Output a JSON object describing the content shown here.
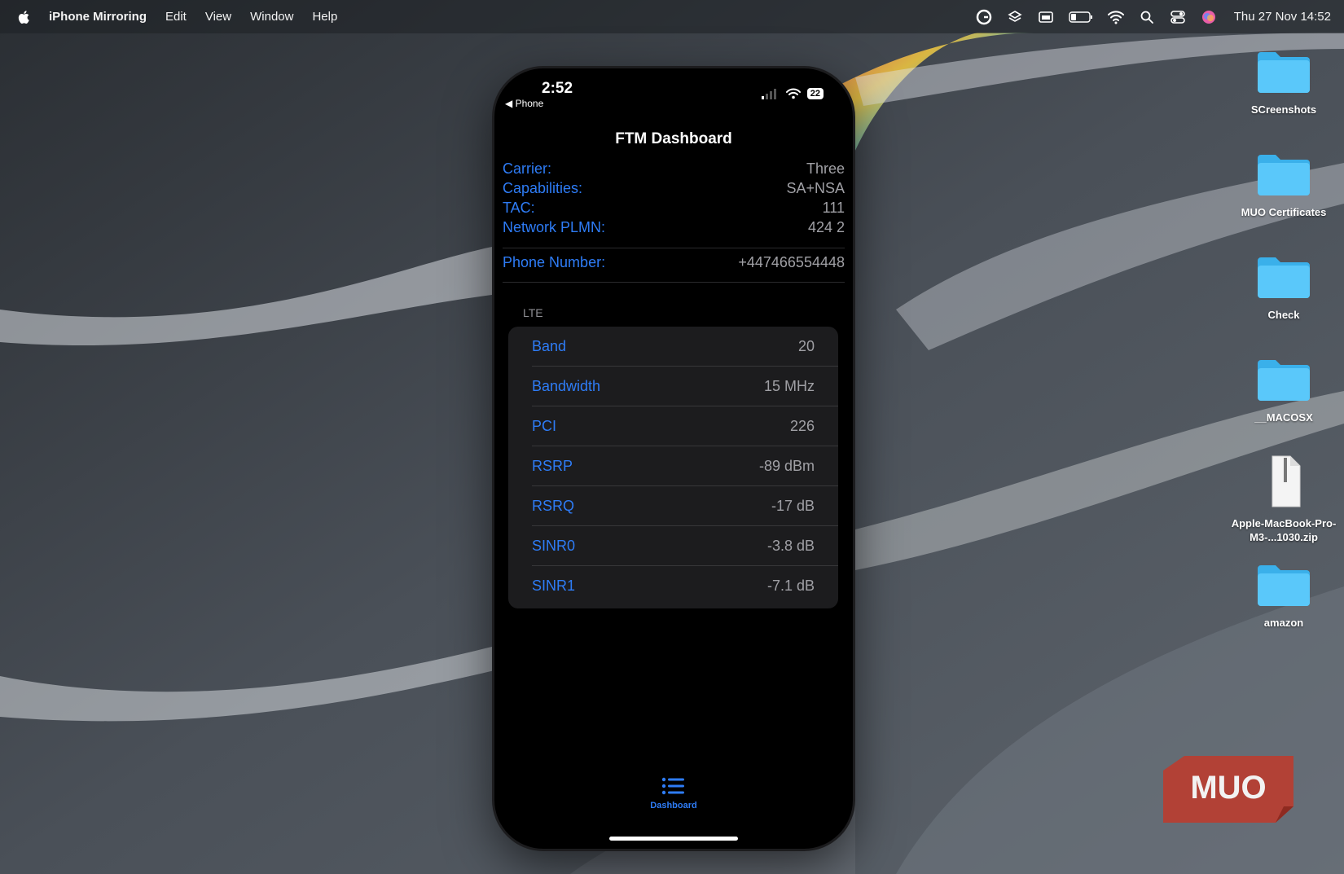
{
  "menubar": {
    "app_name": "iPhone Mirroring",
    "items": [
      "Edit",
      "View",
      "Window",
      "Help"
    ],
    "clock": "Thu 27 Nov  14:52"
  },
  "desktop": {
    "items": [
      {
        "label": "SCreenshots",
        "type": "folder"
      },
      {
        "label": "MUO Certificates",
        "type": "folder"
      },
      {
        "label": "Check",
        "type": "folder"
      },
      {
        "label": "__MACOSX",
        "type": "folder"
      },
      {
        "label": "Apple-MacBook-Pro-M3-...1030.zip",
        "type": "zip",
        "badge": "ZIP"
      },
      {
        "label": "amazon",
        "type": "folder"
      }
    ]
  },
  "phone": {
    "time": "2:52",
    "back_label": "◀ Phone",
    "battery": "22",
    "title": "FTM Dashboard",
    "info": [
      {
        "key": "Carrier:",
        "value": "Three"
      },
      {
        "key": "Capabilities:",
        "value": "SA+NSA"
      },
      {
        "key": "TAC:",
        "value": "111"
      },
      {
        "key": "Network PLMN:",
        "value": "424 2"
      }
    ],
    "phone_number": {
      "key": "Phone Number:",
      "value": "+447466554448"
    },
    "section": "LTE",
    "rows": [
      {
        "key": "Band",
        "value": "20"
      },
      {
        "key": "Bandwidth",
        "value": "15 MHz"
      },
      {
        "key": "PCI",
        "value": "226"
      },
      {
        "key": "RSRP",
        "value": "-89 dBm"
      },
      {
        "key": "RSRQ",
        "value": "-17 dB"
      },
      {
        "key": "SINR0",
        "value": "-3.8 dB"
      },
      {
        "key": "SINR1",
        "value": "-7.1 dB"
      }
    ],
    "tab": {
      "label": "Dashboard",
      "icon": "list-icon"
    }
  },
  "watermark": "MUO",
  "colors": {
    "accent": "#2e7cf6",
    "folder": "#5ac8fa",
    "watermark": "#c0392b"
  }
}
